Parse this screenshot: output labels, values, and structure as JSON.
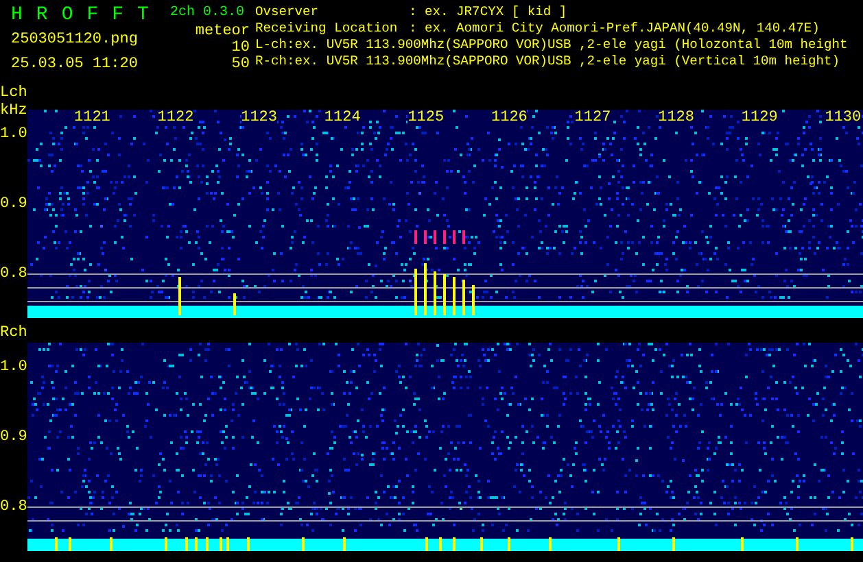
{
  "header": {
    "title_letters": [
      "H",
      "R",
      "O",
      "F",
      "F",
      "T"
    ],
    "version": "2ch 0.3.0",
    "filename": "2503051120.png",
    "timestamp": "25.03.05 11:20",
    "mode": "meteor",
    "counts": [
      "10",
      "50"
    ]
  },
  "info": [
    {
      "kind": "field",
      "label": "Ovserver",
      "value": ": ex. JR7CYX [ kid ]"
    },
    {
      "kind": "field",
      "label": "Receiving Location",
      "value": ": ex. Aomori City Aomori-Pref.JAPAN(40.49N, 140.47E)"
    },
    {
      "kind": "line",
      "label": "L-ch:ex. UV5R 113.900Mhz(SAPPORO VOR)USB ,2-ele yagi (Holozontal 10m height"
    },
    {
      "kind": "line",
      "label": "R-ch:ex. UV5R 113.900Mhz(SAPPORO VOR)USB ,2-ele yagi (Vertical 10m height)"
    }
  ],
  "panels": [
    {
      "channel": "Lch",
      "unit": "kHz",
      "freq_labels": [
        "1121",
        "1122",
        "1123",
        "1124",
        "1125",
        "1126",
        "1127",
        "1128",
        "1129",
        "1130"
      ],
      "y_labels": [
        "1.0",
        "0.9",
        "0.8"
      ]
    },
    {
      "channel": "Rch",
      "y_labels": [
        "1.0",
        "0.9",
        "0.8"
      ]
    }
  ]
}
